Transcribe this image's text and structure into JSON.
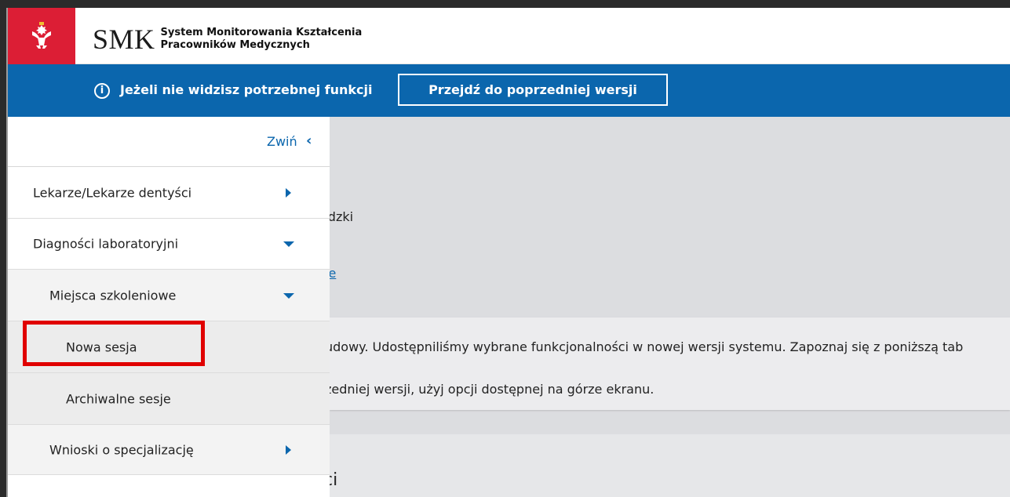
{
  "header": {
    "abbr": "SMK",
    "name_line1": "System Monitorowania Kształcenia",
    "name_line2": "Pracowników Medycznych"
  },
  "infobar": {
    "info_icon": "info-circle-icon",
    "text": "Jeżeli nie widzisz potrzebnej funkcji",
    "button_label": "Przejdź do poprzedniej wersji"
  },
  "sidebar": {
    "collapse_label": "Zwiń",
    "collapse_icon": "chevron-left-icon",
    "items": [
      {
        "label": "Lekarze/Lekarze dentyści",
        "icon": "caret-right-icon"
      },
      {
        "label": "Diagności laboratoryjni",
        "icon": "caret-down-icon"
      },
      {
        "label": "Miejsca szkoleniowe",
        "icon": "caret-down-icon"
      },
      {
        "label": "Nowa sesja"
      },
      {
        "label": "Archiwalne sesje"
      },
      {
        "label": "Wnioski o specjalizację",
        "icon": "caret-right-icon"
      }
    ]
  },
  "main": {
    "text_fragment": "ódzki",
    "link_fragment": "je",
    "notice_line1": "udowy. Udostępniliśmy wybrane funkcjonalności w nowej wersji systemu. Zapoznaj się z poniższą tab",
    "notice_line2": "zedniej wersji, użyj opcji dostępnej na górze ekranu.",
    "section_fragment": "ci"
  },
  "colors": {
    "brand_blue": "#0b66ad",
    "emblem_red": "#dc1e35",
    "highlight_red": "#e00000"
  }
}
